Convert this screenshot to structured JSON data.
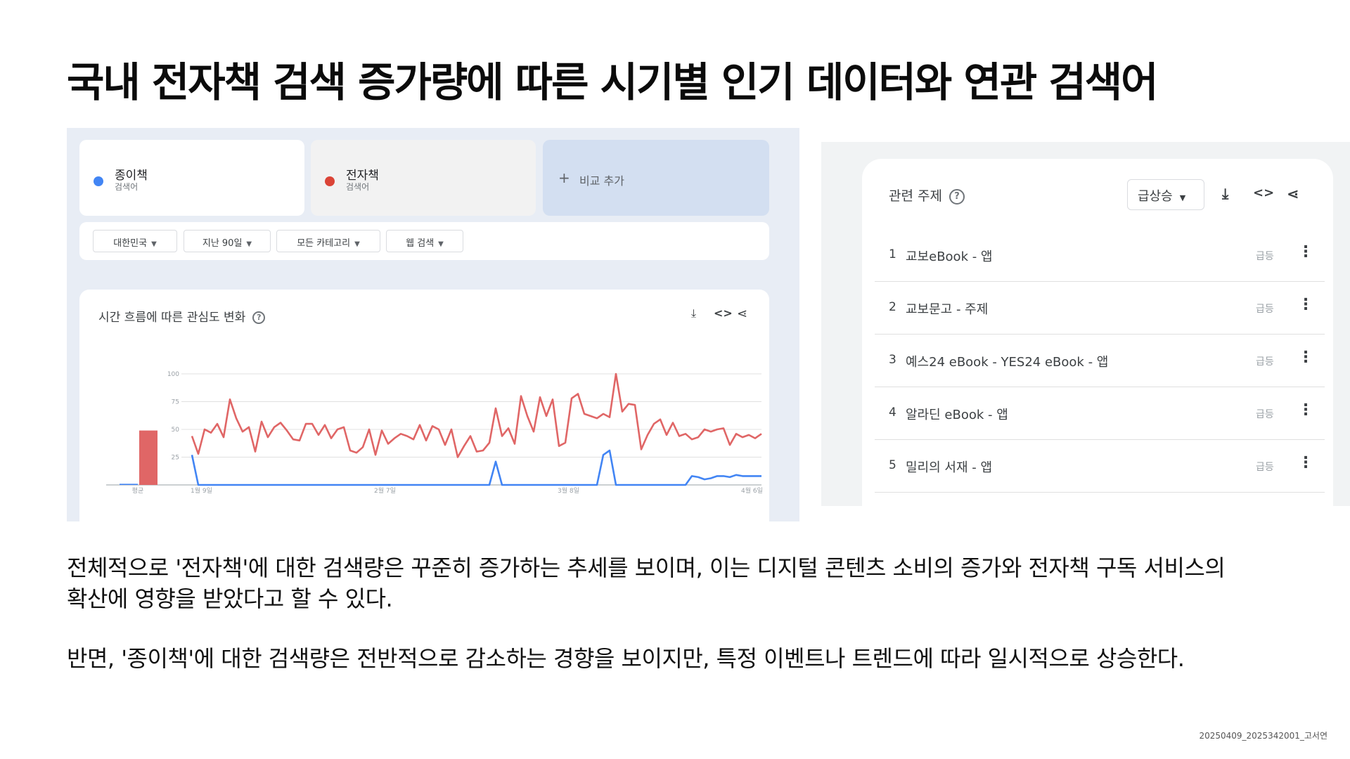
{
  "slide": {
    "title": "국내 전자책 검색 증가량에 따른 시기별 인기 데이터와 연관 검색어",
    "paragraph_1_line_1": "전체적으로 '전자책'에 대한 검색량은 꾸준히 증가하는 추세를 보이며, 이는 디지털 콘텐츠 소비의 증가와 전자책 구독 서비스의",
    "paragraph_1_line_2": "확산에 영향을 받았다고 할 수 있다.",
    "paragraph_2": "반면, '종이책'에 대한 검색량은 전반적으로 감소하는 경향을 보이지만, 특정 이벤트나 트렌드에 따라 일시적으로 상승한다.",
    "footer_id": "20250409_2025342001_고서연"
  },
  "trends": {
    "terms": [
      {
        "name": "종이책",
        "sub": "검색어",
        "color": "#4285f4"
      },
      {
        "name": "전자책",
        "sub": "검색어",
        "color": "#db4437"
      }
    ],
    "add_compare": "비교 추가",
    "filters": [
      {
        "label": "대한민국"
      },
      {
        "label": "지난 90일"
      },
      {
        "label": "모든 카테고리"
      },
      {
        "label": "웹 검색"
      }
    ],
    "chart_title": "시간 흐름에 따른 관심도 변화"
  },
  "chart_data": {
    "type": "line",
    "title": "시간 흐름에 따른 관심도 변화",
    "ylim": [
      0,
      100
    ],
    "y_ticks": [
      "100",
      "75",
      "50",
      "25"
    ],
    "x_tick_labels": [
      "1월 9일",
      "2월 7일",
      "3월 8일",
      "4월 6일"
    ],
    "x_tick_days": [
      0,
      29,
      58,
      87
    ],
    "average_label": "평균",
    "average_bars": [
      {
        "name": "종이책",
        "value": 1,
        "color": "#4285f4"
      },
      {
        "name": "전자책",
        "value": 49,
        "color": "#e06666"
      }
    ],
    "series": [
      {
        "name": "전자책",
        "color": "#e06666",
        "values": [
          44,
          28,
          50,
          47,
          55,
          43,
          77,
          60,
          48,
          52,
          30,
          57,
          43,
          52,
          56,
          49,
          41,
          40,
          55,
          55,
          45,
          54,
          42,
          50,
          52,
          31,
          29,
          34,
          50,
          27,
          49,
          37,
          42,
          46,
          44,
          41,
          54,
          40,
          53,
          50,
          36,
          50,
          25,
          35,
          44,
          30,
          31,
          38,
          69,
          44,
          51,
          37,
          80,
          62,
          48,
          79,
          62,
          77,
          35,
          38,
          78,
          82,
          64,
          62,
          60,
          64,
          61,
          100,
          66,
          73,
          72,
          32,
          45,
          55,
          59,
          45,
          56,
          44,
          46,
          41,
          43,
          50,
          48,
          50,
          51,
          36,
          46,
          43,
          45,
          42,
          46
        ]
      },
      {
        "name": "종이책",
        "color": "#4285f4",
        "values": [
          27,
          0,
          0,
          0,
          0,
          0,
          0,
          0,
          0,
          0,
          0,
          0,
          0,
          0,
          0,
          0,
          0,
          0,
          0,
          0,
          0,
          0,
          0,
          0,
          0,
          0,
          0,
          0,
          0,
          0,
          0,
          0,
          0,
          0,
          0,
          0,
          0,
          0,
          0,
          0,
          0,
          0,
          0,
          0,
          0,
          0,
          0,
          0,
          21,
          0,
          0,
          0,
          0,
          0,
          0,
          0,
          0,
          0,
          0,
          0,
          0,
          0,
          0,
          0,
          0,
          27,
          31,
          0,
          0,
          0,
          0,
          0,
          0,
          0,
          0,
          0,
          0,
          0,
          0,
          8,
          7,
          5,
          6,
          8,
          8,
          7,
          9,
          8,
          8,
          8,
          8
        ]
      }
    ]
  },
  "related": {
    "title": "관련 주제",
    "sort_label": "급상승",
    "items": [
      {
        "rank": "1",
        "text": "교보eBook - 앱",
        "badge": "급등"
      },
      {
        "rank": "2",
        "text": "교보문고 - 주제",
        "badge": "급등"
      },
      {
        "rank": "3",
        "text": "예스24 eBook - YES24 eBook - 앱",
        "badge": "급등"
      },
      {
        "rank": "4",
        "text": "알라딘 eBook - 앱",
        "badge": "급등"
      },
      {
        "rank": "5",
        "text": "밀리의 서재 - 앱",
        "badge": "급등"
      }
    ]
  }
}
